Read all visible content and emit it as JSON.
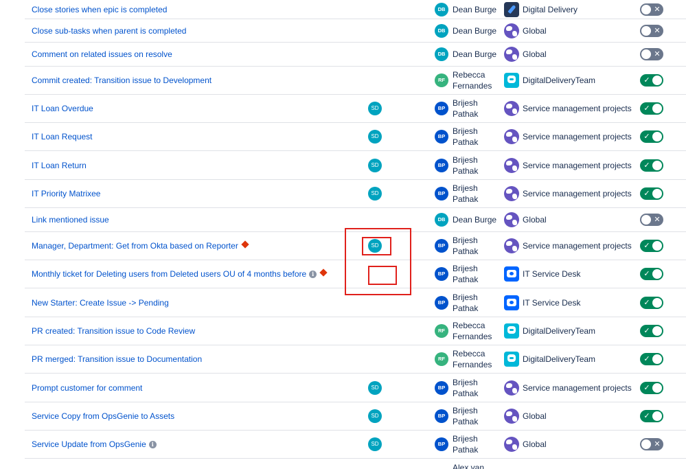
{
  "rules": [
    {
      "name": "Close stories when epic is completed",
      "sd": "",
      "owner_initials": "DB",
      "owner_name": "Dean Burge",
      "scope": "Digital Delivery",
      "scope_icon": "rocket-icon",
      "enabled": false,
      "info": false,
      "warning": false
    },
    {
      "name": "Close sub-tasks when parent is completed",
      "sd": "",
      "owner_initials": "DB",
      "owner_name": "Dean Burge",
      "scope": "Global",
      "scope_icon": "globe-icon",
      "enabled": false,
      "info": false,
      "warning": false
    },
    {
      "name": "Comment on related issues on resolve",
      "sd": "",
      "owner_initials": "DB",
      "owner_name": "Dean Burge",
      "scope": "Global",
      "scope_icon": "globe-icon",
      "enabled": false,
      "info": false,
      "warning": false
    },
    {
      "name": "Commit created: Transition issue to Development",
      "sd": "",
      "owner_initials": "RF",
      "owner_name": "Rebecca Fernandes",
      "scope": "DigitalDeliveryTeam",
      "scope_icon": "robot-icon",
      "enabled": true,
      "info": false,
      "warning": false
    },
    {
      "name": "IT Loan Overdue",
      "sd": "SD",
      "owner_initials": "BP",
      "owner_name": "Brijesh Pathak",
      "scope": "Service management projects",
      "scope_icon": "globe-icon",
      "enabled": true,
      "info": false,
      "warning": false
    },
    {
      "name": "IT Loan Request",
      "sd": "SD",
      "owner_initials": "BP",
      "owner_name": "Brijesh Pathak",
      "scope": "Service management projects",
      "scope_icon": "globe-icon",
      "enabled": true,
      "info": false,
      "warning": false
    },
    {
      "name": "IT Loan Return",
      "sd": "SD",
      "owner_initials": "BP",
      "owner_name": "Brijesh Pathak",
      "scope": "Service management projects",
      "scope_icon": "globe-icon",
      "enabled": true,
      "info": false,
      "warning": false
    },
    {
      "name": "IT Priority Matrixee",
      "sd": "SD",
      "owner_initials": "BP",
      "owner_name": "Brijesh Pathak",
      "scope": "Service management projects",
      "scope_icon": "globe-icon",
      "enabled": true,
      "info": false,
      "warning": false
    },
    {
      "name": "Link mentioned issue",
      "sd": "",
      "owner_initials": "DB",
      "owner_name": "Dean Burge",
      "scope": "Global",
      "scope_icon": "globe-icon",
      "enabled": false,
      "info": false,
      "warning": false
    },
    {
      "name": "Manager, Department: Get from Okta based on Reporter",
      "sd": "SD",
      "owner_initials": "BP",
      "owner_name": "Brijesh Pathak",
      "scope": "Service management projects",
      "scope_icon": "globe-icon",
      "enabled": true,
      "info": false,
      "warning": true
    },
    {
      "name": "Monthly ticket for Deleting users from Deleted users OU of 4 months before",
      "sd": "",
      "owner_initials": "BP",
      "owner_name": "Brijesh Pathak",
      "scope": "IT Service Desk",
      "scope_icon": "service-desk-icon",
      "enabled": true,
      "info": true,
      "warning": true
    },
    {
      "name": "New Starter: Create Issue -> Pending",
      "sd": "",
      "owner_initials": "BP",
      "owner_name": "Brijesh Pathak",
      "scope": "IT Service Desk",
      "scope_icon": "service-desk-icon",
      "enabled": true,
      "info": false,
      "warning": false
    },
    {
      "name": "PR created: Transition issue to Code Review",
      "sd": "",
      "owner_initials": "RF",
      "owner_name": "Rebecca Fernandes",
      "scope": "DigitalDeliveryTeam",
      "scope_icon": "robot-icon",
      "enabled": true,
      "info": false,
      "warning": false
    },
    {
      "name": "PR merged: Transition issue to Documentation",
      "sd": "",
      "owner_initials": "RF",
      "owner_name": "Rebecca Fernandes",
      "scope": "DigitalDeliveryTeam",
      "scope_icon": "robot-icon",
      "enabled": true,
      "info": false,
      "warning": false
    },
    {
      "name": "Prompt customer for comment",
      "sd": "SD",
      "owner_initials": "BP",
      "owner_name": "Brijesh Pathak",
      "scope": "Service management projects",
      "scope_icon": "globe-icon",
      "enabled": true,
      "info": false,
      "warning": false
    },
    {
      "name": "Service Copy from OpsGenie to Assets",
      "sd": "SD",
      "owner_initials": "BP",
      "owner_name": "Brijesh Pathak",
      "scope": "Global",
      "scope_icon": "globe-icon",
      "enabled": true,
      "info": false,
      "warning": false
    },
    {
      "name": "Service Update from OpsGenie",
      "sd": "SD",
      "owner_initials": "BP",
      "owner_name": "Brijesh Pathak",
      "scope": "Global",
      "scope_icon": "globe-icon",
      "enabled": false,
      "info": true,
      "warning": false
    }
  ],
  "partial_row_owner": "Alex van",
  "colors": {
    "link": "#0052cc",
    "toggle_on": "#00875a",
    "toggle_off": "#6b778c",
    "highlight": "#e0201b"
  }
}
